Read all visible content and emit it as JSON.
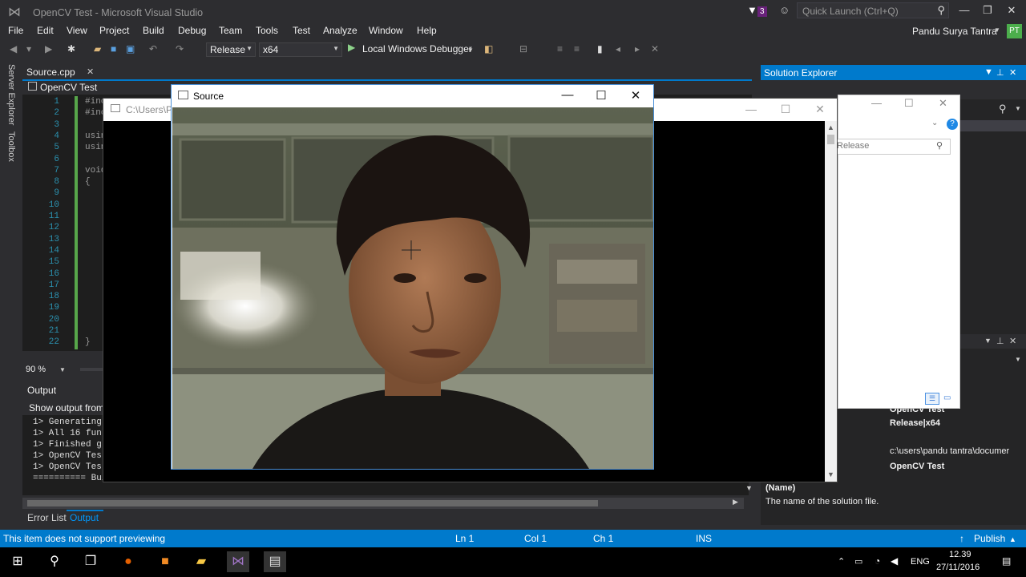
{
  "app": {
    "title": "OpenCV Test - Microsoft Visual Studio",
    "notification_count": "3",
    "quick_launch_placeholder": "Quick Launch (Ctrl+Q)",
    "user_name": "Pandu Surya Tantra",
    "user_initials": "PT"
  },
  "menu": [
    "File",
    "Edit",
    "View",
    "Project",
    "Build",
    "Debug",
    "Team",
    "Tools",
    "Test",
    "Analyze",
    "Window",
    "Help"
  ],
  "toolbar": {
    "configuration": "Release",
    "platform": "x64",
    "run_label": "Local Windows Debugger"
  },
  "side_tabs": [
    "Server Explorer",
    "Toolbox"
  ],
  "editor": {
    "tab_label": "Source.cpp",
    "project_label": "OpenCV Test",
    "line_numbers": [
      "1",
      "2",
      "3",
      "4",
      "5",
      "6",
      "7",
      "8",
      "9",
      "10",
      "11",
      "12",
      "13",
      "14",
      "15",
      "16",
      "17",
      "18",
      "19",
      "20",
      "21",
      "22"
    ],
    "visible_code": [
      "#inc",
      "#inc",
      "",
      "usin",
      "usin",
      "",
      "void",
      "{",
      "",
      "",
      "",
      "",
      "",
      "",
      "",
      "",
      "",
      "",
      "",
      "",
      "",
      "}"
    ],
    "zoom": "90 %"
  },
  "output": {
    "title": "Output",
    "show_output_from": "Show output from:",
    "lines": [
      "1>  Generating",
      "1>  All 16 fun",
      "1>  Finished g",
      "1>  OpenCV Tes",
      "1>  OpenCV Tes",
      "========== Bui"
    ],
    "tabs": [
      "Error List",
      "Output"
    ]
  },
  "solution_explorer": {
    "title": "Solution Explorer",
    "search_text": "Release"
  },
  "properties": {
    "values": [
      "OpenCV Test",
      "Release|x64",
      "c:\\users\\pandu tantra\\documer",
      "OpenCV Test"
    ],
    "name_label": "(Name)",
    "description": "The name of the solution file."
  },
  "console": {
    "title": "C:\\Users\\Pa"
  },
  "source_window": {
    "title": "Source"
  },
  "status": {
    "message": "This item does not support previewing",
    "ln": "Ln 1",
    "col": "Col 1",
    "ch": "Ch 1",
    "mode": "INS",
    "publish": "Publish"
  },
  "taskbar": {
    "language": "ENG",
    "time": "12.39",
    "date": "27/11/2016"
  },
  "colors": {
    "accent": "#007acc",
    "editor_bg": "#1e1e1e",
    "chrome_bg": "#2d2d30"
  }
}
